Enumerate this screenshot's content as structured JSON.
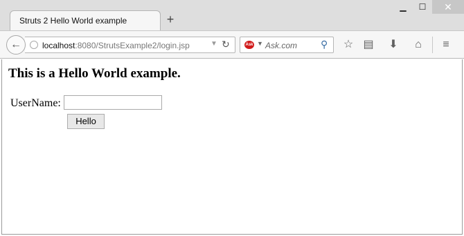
{
  "tab": {
    "title": "Struts 2 Hello World example",
    "new_tab_glyph": "+"
  },
  "window_controls": {
    "minimize_glyph": "▁",
    "maximize_glyph": "☐",
    "close_glyph": "✕"
  },
  "urlbar": {
    "host": "localhost",
    "path": ":8080/StrutsExample2/login.jsp"
  },
  "searchbar": {
    "engine_icon_text": "Ask",
    "placeholder": "Ask.com"
  },
  "toolbar_icons": [
    "bookmark-star-icon",
    "reading-list-icon",
    "download-icon",
    "home-icon",
    "menu-icon"
  ],
  "page": {
    "heading": "This is a Hello World example.",
    "username_label": "UserName:",
    "username_value": "",
    "submit_label": "Hello"
  },
  "colors": {
    "titlebar_bg": "#dedede",
    "toolbar_bg": "#f6f6f6",
    "ask_brand": "#d11a1a"
  }
}
